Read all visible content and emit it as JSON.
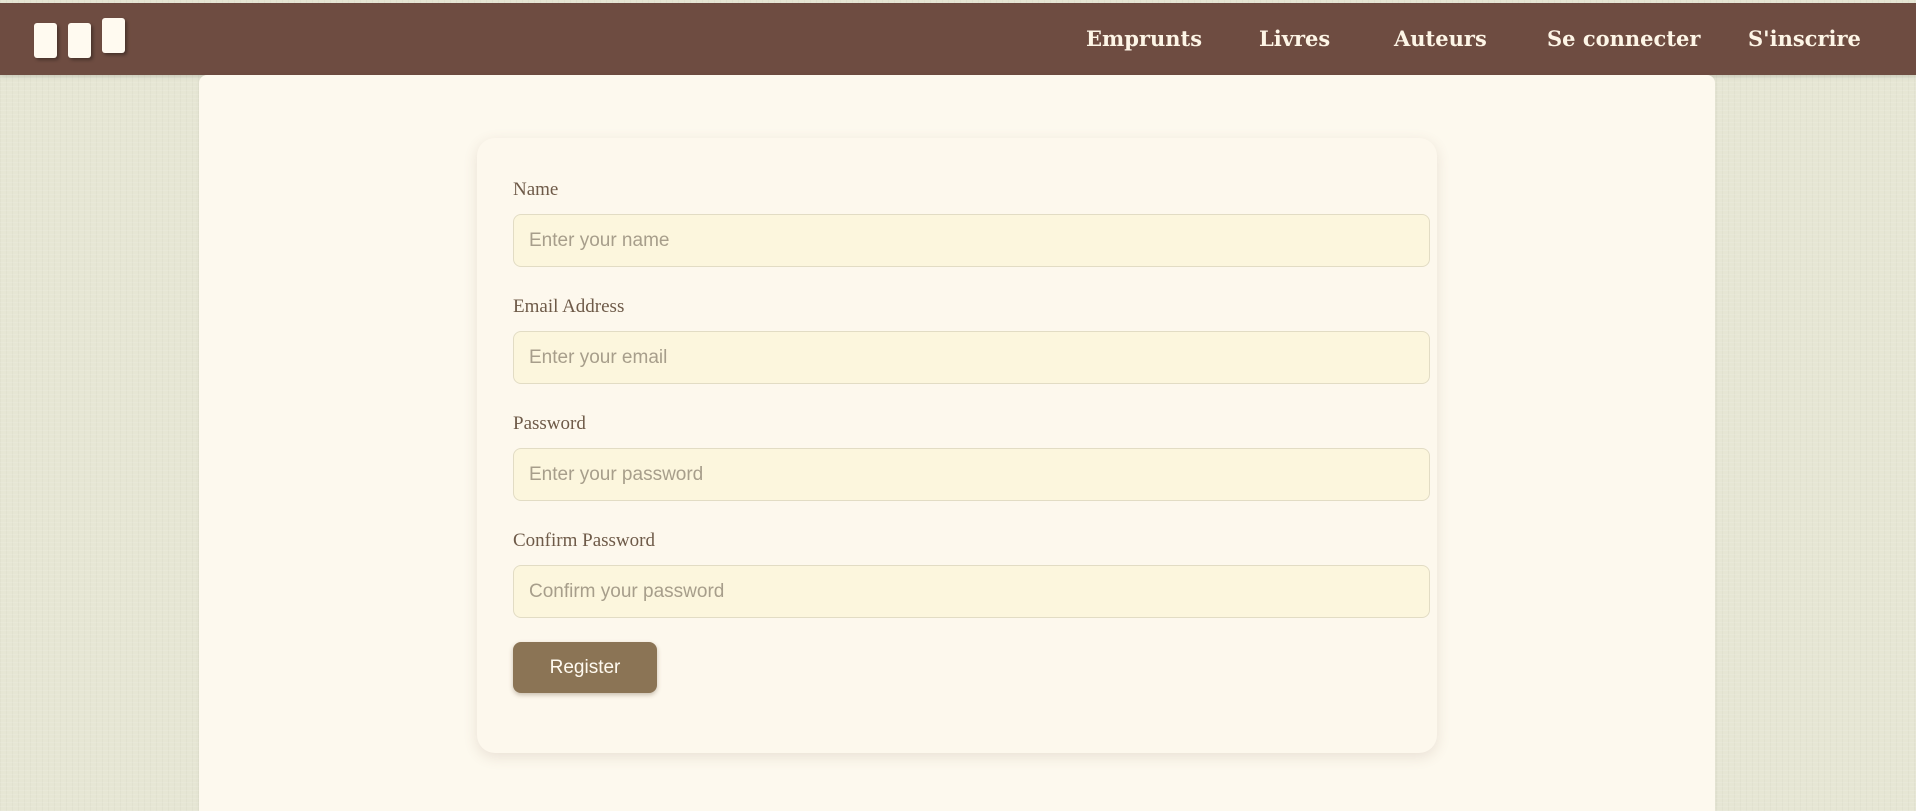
{
  "navbar": {
    "logo": "books-logo-icon",
    "links": [
      {
        "label": "Emprunts"
      },
      {
        "label": "Livres"
      },
      {
        "label": "Auteurs"
      },
      {
        "label": "Se connecter"
      },
      {
        "label": "S'inscrire"
      }
    ]
  },
  "form": {
    "fields": [
      {
        "label": "Name",
        "placeholder": "Enter your name",
        "value": ""
      },
      {
        "label": "Email Address",
        "placeholder": "Enter your email",
        "value": ""
      },
      {
        "label": "Password",
        "placeholder": "Enter your password",
        "value": ""
      },
      {
        "label": "Confirm Password",
        "placeholder": "Confirm your password",
        "value": ""
      }
    ],
    "submit_label": "Register"
  },
  "colors": {
    "navbar": "#6e4c41",
    "page_background": "#e6e6d4",
    "panel_background": "#fdf9ee",
    "input_background": "#fcf6dd",
    "button": "#8b7455"
  }
}
